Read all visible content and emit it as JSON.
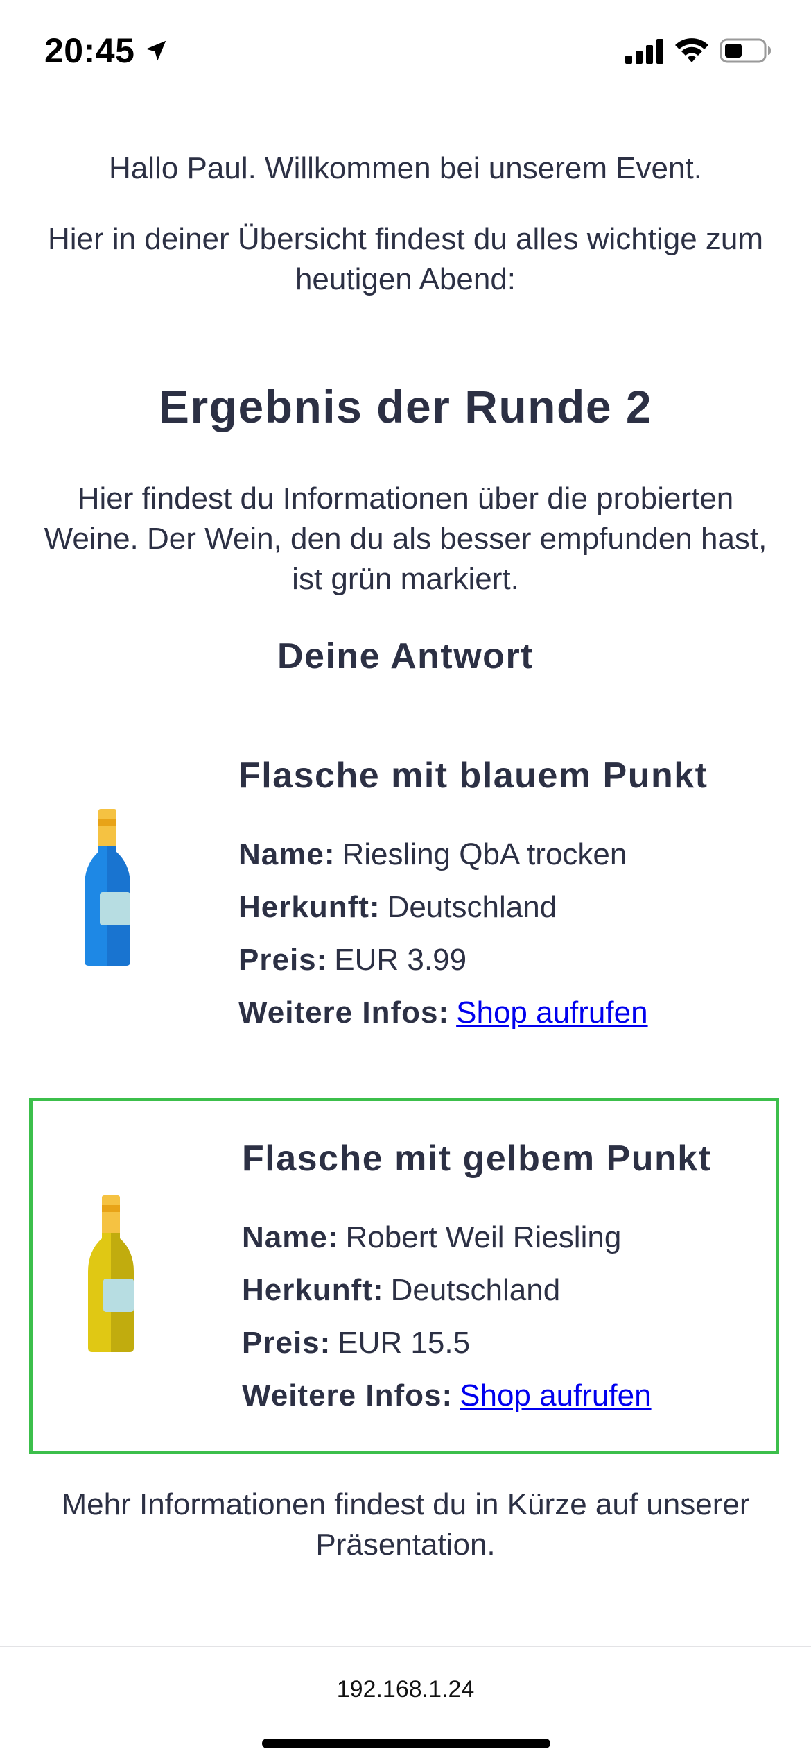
{
  "status_bar": {
    "time": "20:45",
    "icons": [
      "location-arrow-icon",
      "signal-icon",
      "wifi-icon",
      "battery-icon"
    ]
  },
  "greeting": "Hallo Paul. Willkommen bei unserem Event.",
  "intro": "Hier in deiner Übersicht findest du alles wichtige zum heutigen Abend:",
  "round": {
    "title": "Ergebnis der Runde 2",
    "description": "Hier findest du Informationen über die probierten Weine. Der Wein, den du als besser empfunden hast, ist grün markiert.",
    "answer_heading": "Deine Antwort"
  },
  "wines": [
    {
      "title": "Flasche mit blauem Punkt",
      "icon": "blue-wine-bottle-icon",
      "bottle_color": "#1e88e5",
      "selected": false,
      "name_label": "Name:",
      "name": "Riesling QbA trocken",
      "origin_label": "Herkunft:",
      "origin": "Deutschland",
      "price_label": "Preis:",
      "price": "EUR 3.99",
      "more_label": "Weitere Infos:",
      "link_text": "Shop aufrufen"
    },
    {
      "title": "Flasche mit gelbem Punkt",
      "icon": "yellow-wine-bottle-icon",
      "bottle_color": "#e0c814",
      "selected": true,
      "name_label": "Name:",
      "name": "Robert Weil Riesling",
      "origin_label": "Herkunft:",
      "origin": "Deutschland",
      "price_label": "Preis:",
      "price": "EUR 15.5",
      "more_label": "Weitere Infos:",
      "link_text": "Shop aufrufen"
    }
  ],
  "footer_note": "Mehr Informationen findest du in Kürze auf unserer Präsentation.",
  "browser": {
    "url": "192.168.1.24"
  },
  "colors": {
    "text": "#2c3044",
    "highlight_border": "#3cbf4b",
    "link": "#0000ee"
  }
}
